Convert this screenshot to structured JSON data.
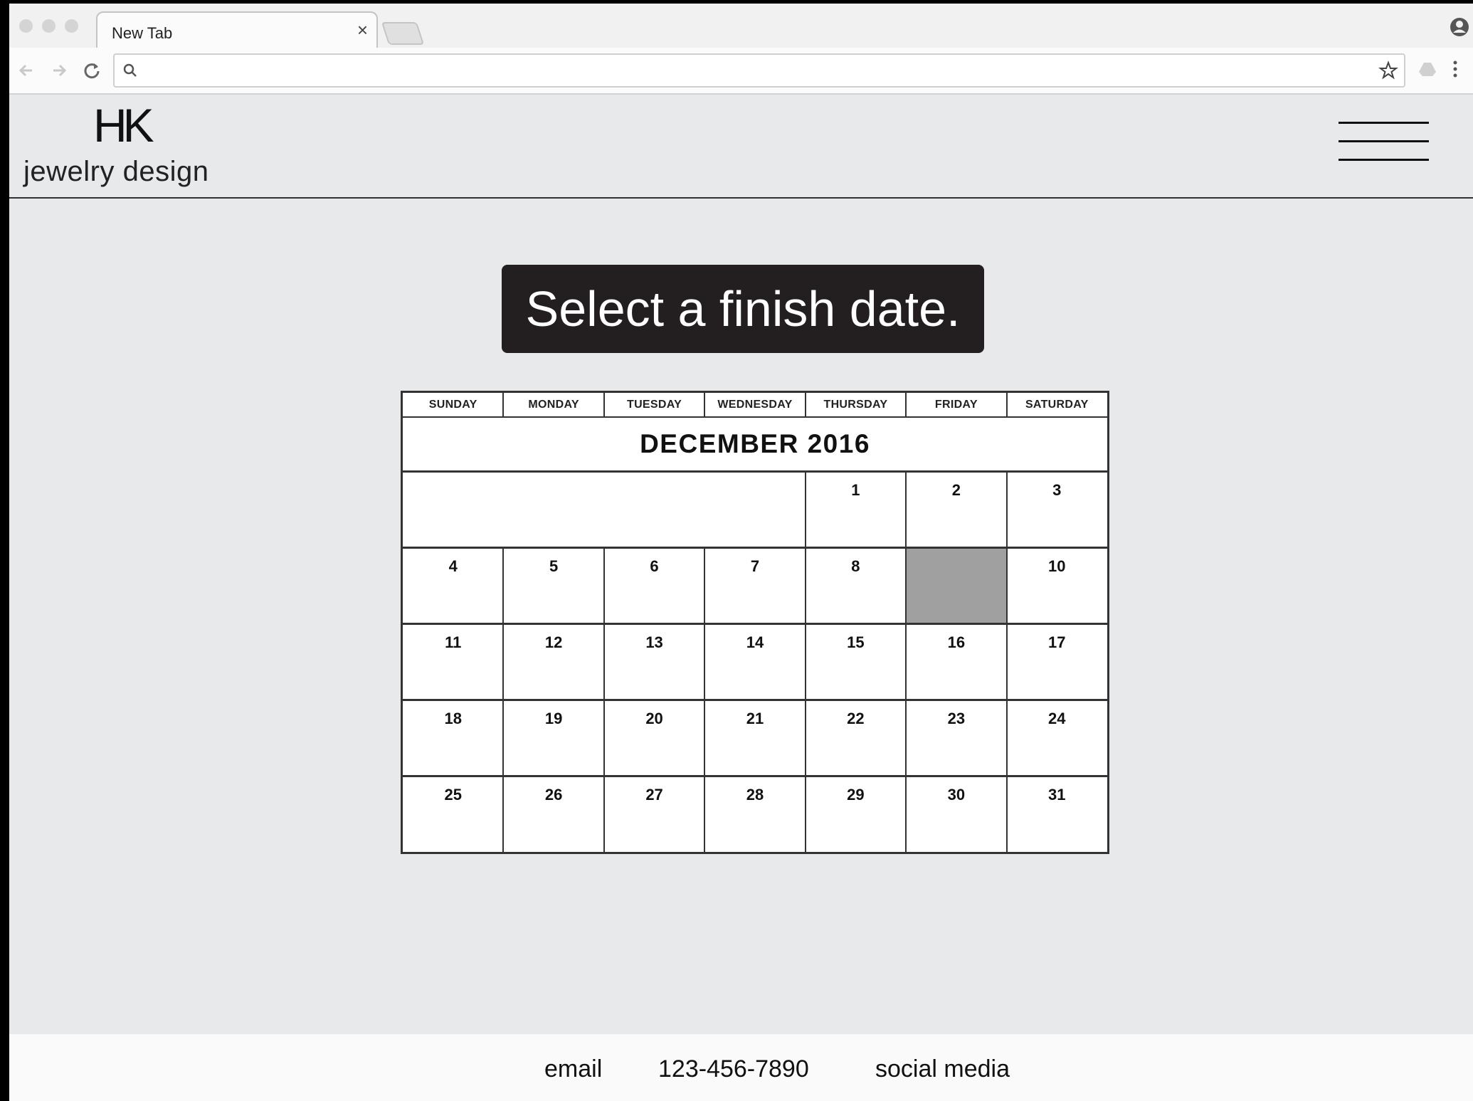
{
  "browser": {
    "tab_title": "New Tab",
    "tab_close": "×",
    "address_value": ""
  },
  "site": {
    "logo_mark": "HK",
    "logo_text": "jewelry design"
  },
  "prompt": "Select a finish date.",
  "calendar": {
    "month_title": "DECEMBER 2016",
    "day_names": [
      "SUNDAY",
      "MONDAY",
      "TUESDAY",
      "WEDNESDAY",
      "THURSDAY",
      "FRIDAY",
      "SATURDAY"
    ],
    "weeks": [
      [
        "",
        "",
        "",
        "",
        "1",
        "2",
        "3"
      ],
      [
        "4",
        "5",
        "6",
        "7",
        "8",
        "",
        "10"
      ],
      [
        "11",
        "12",
        "13",
        "14",
        "15",
        "16",
        "17"
      ],
      [
        "18",
        "19",
        "20",
        "21",
        "22",
        "23",
        "24"
      ],
      [
        "25",
        "26",
        "27",
        "28",
        "29",
        "30",
        "31"
      ]
    ],
    "selected_week": 1,
    "selected_day_index": 5,
    "selected_color": "#a0a0a0"
  },
  "footer": {
    "email": "email",
    "phone": "123-456-7890",
    "social": "social media"
  }
}
